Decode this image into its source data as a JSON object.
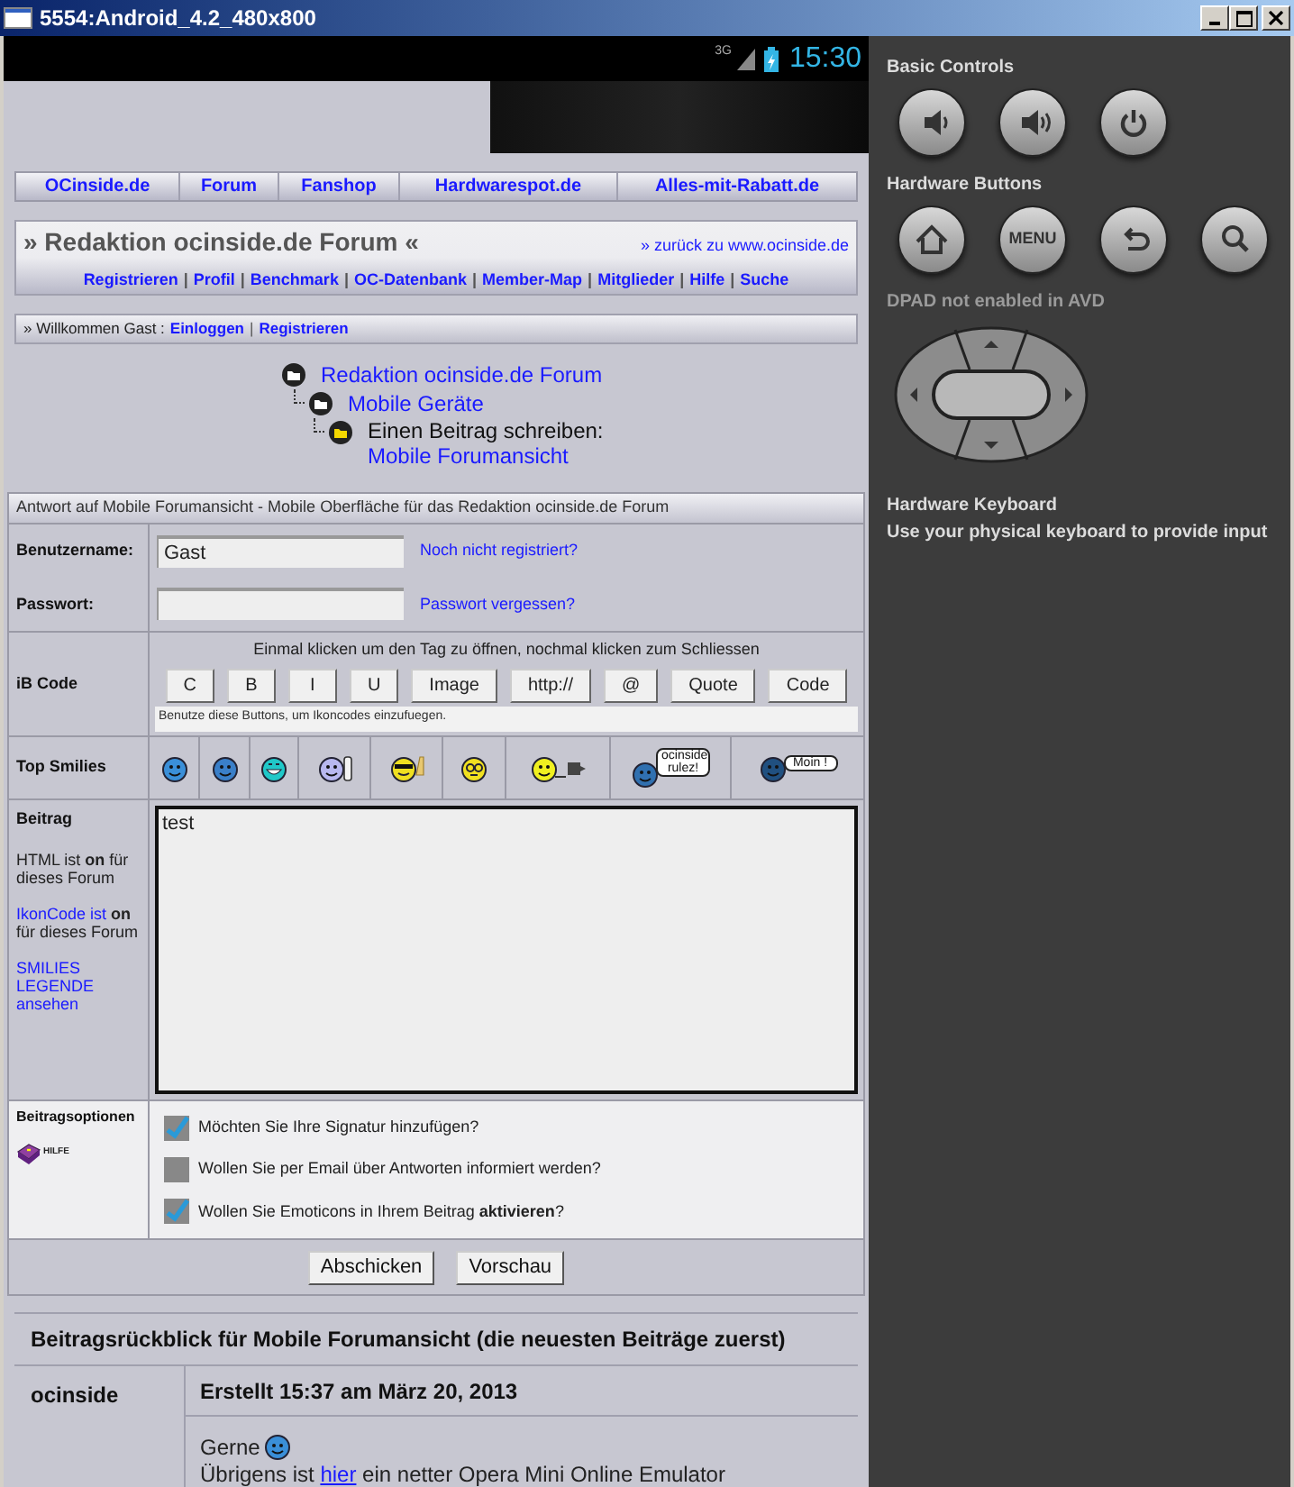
{
  "window": {
    "title": "5554:Android_4.2_480x800"
  },
  "status_bar": {
    "network": "3G",
    "time": "15:30"
  },
  "nav": [
    {
      "label": "OCinside.de"
    },
    {
      "label": "Forum"
    },
    {
      "label": "Fanshop"
    },
    {
      "label": "Hardwarespot.de"
    },
    {
      "label": "Alles-mit-Rabatt.de"
    }
  ],
  "forum_header": {
    "title": "» Redaktion ocinside.de Forum «",
    "back_link": "» zurück zu www.ocinside.de",
    "links": [
      "Registrieren",
      "Profil",
      "Benchmark",
      "OC-Datenbank",
      "Member-Map",
      "Mitglieder",
      "Hilfe",
      "Suche"
    ],
    "separator": "|"
  },
  "welcome": {
    "text": "» Willkommen Gast :",
    "links": [
      "Einloggen",
      "Registrieren"
    ],
    "separator": "|"
  },
  "breadcrumb": [
    {
      "label": "Redaktion ocinside.de Forum",
      "current": false,
      "children": [
        {
          "label": "Mobile Geräte",
          "current": false,
          "children": [
            {
              "prefix": "Einen Beitrag schreiben:",
              "label": "Mobile Forumansicht",
              "current": true
            }
          ]
        }
      ]
    }
  ],
  "form": {
    "heading": "Antwort auf Mobile Forumansicht - Mobile Oberfläche für das Redaktion ocinside.de Forum",
    "username": {
      "label": "Benutzername:",
      "value": "Gast",
      "link": "Noch nicht registriert?"
    },
    "password": {
      "label": "Passwort:",
      "link": "Passwort vergessen?"
    },
    "ibcode": {
      "label": "iB Code",
      "hint": "Einmal klicken um den Tag zu öffnen, nochmal klicken zum Schliessen",
      "buttons": [
        "C",
        "B",
        "I",
        "U",
        "Image",
        "http://",
        "@",
        "Quote",
        "Code"
      ],
      "helper": "Benutze diese Buttons, um Ikoncodes einzufuegen."
    },
    "smilies": {
      "label": "Top Smilies",
      "items": [
        {
          "kind": "face",
          "color": "#3a8fd8"
        },
        {
          "kind": "face",
          "color": "#3a7fc8"
        },
        {
          "kind": "grin",
          "color": "#20c8c8"
        },
        {
          "kind": "thumb",
          "color": "#b8b8f0"
        },
        {
          "kind": "cool",
          "color": "#f0e020"
        },
        {
          "kind": "glasses",
          "color": "#f0e020"
        },
        {
          "kind": "pc",
          "color": "#f0f020"
        },
        {
          "kind": "bubble",
          "color": "#3070b0",
          "text": "ocinside rulez!"
        },
        {
          "kind": "bubble",
          "color": "#205080",
          "text": "Moin !"
        }
      ]
    },
    "post": {
      "label": "Beitrag",
      "html_note": "HTML ist **on** für dieses Forum",
      "ikoncode": {
        "link": "IkonCode ist",
        "text": "**on** für dieses Forum"
      },
      "legend_link": "SMILIES LEGENDE ansehen",
      "value": "test"
    },
    "options": {
      "label": "Beitragsoptionen",
      "help": "HILFE",
      "items": [
        {
          "text": "Möchten Sie Ihre Signatur hinzufügen?",
          "checked": true
        },
        {
          "text": "Wollen Sie per Email über Antworten informiert werden?",
          "checked": false
        },
        {
          "text": "Wollen Sie Emoticons in Ihrem Beitrag **aktivieren**?",
          "checked": true
        }
      ]
    },
    "buttons": [
      "Abschicken",
      "Vorschau"
    ]
  },
  "review": {
    "title": "Beitragsrückblick für Mobile Forumansicht (die neuesten Beiträge zuerst)",
    "posts": [
      {
        "author": "ocinside",
        "date": "Erstellt 15:37 am März 20, 2013",
        "greeting": "Gerne",
        "line": {
          "before": "Übrigens ist",
          "link": "hier",
          "after": "ein netter Opera Mini Online Emulator"
        }
      }
    ]
  },
  "emulator": {
    "sections": [
      {
        "title": "Basic Controls",
        "buttons": [
          {
            "kind": "volume-down"
          },
          {
            "kind": "volume-up"
          },
          {
            "kind": "power"
          }
        ]
      },
      {
        "title": "Hardware Buttons",
        "buttons": [
          {
            "kind": "home"
          },
          {
            "kind": "menu",
            "label": "MENU"
          },
          {
            "kind": "back"
          },
          {
            "kind": "search"
          }
        ]
      }
    ],
    "dpad": "**DPAD** not enabled in AVD",
    "keyboard": {
      "title": "Hardware Keyboard",
      "text": "Use your physical keyboard to provide input"
    }
  }
}
